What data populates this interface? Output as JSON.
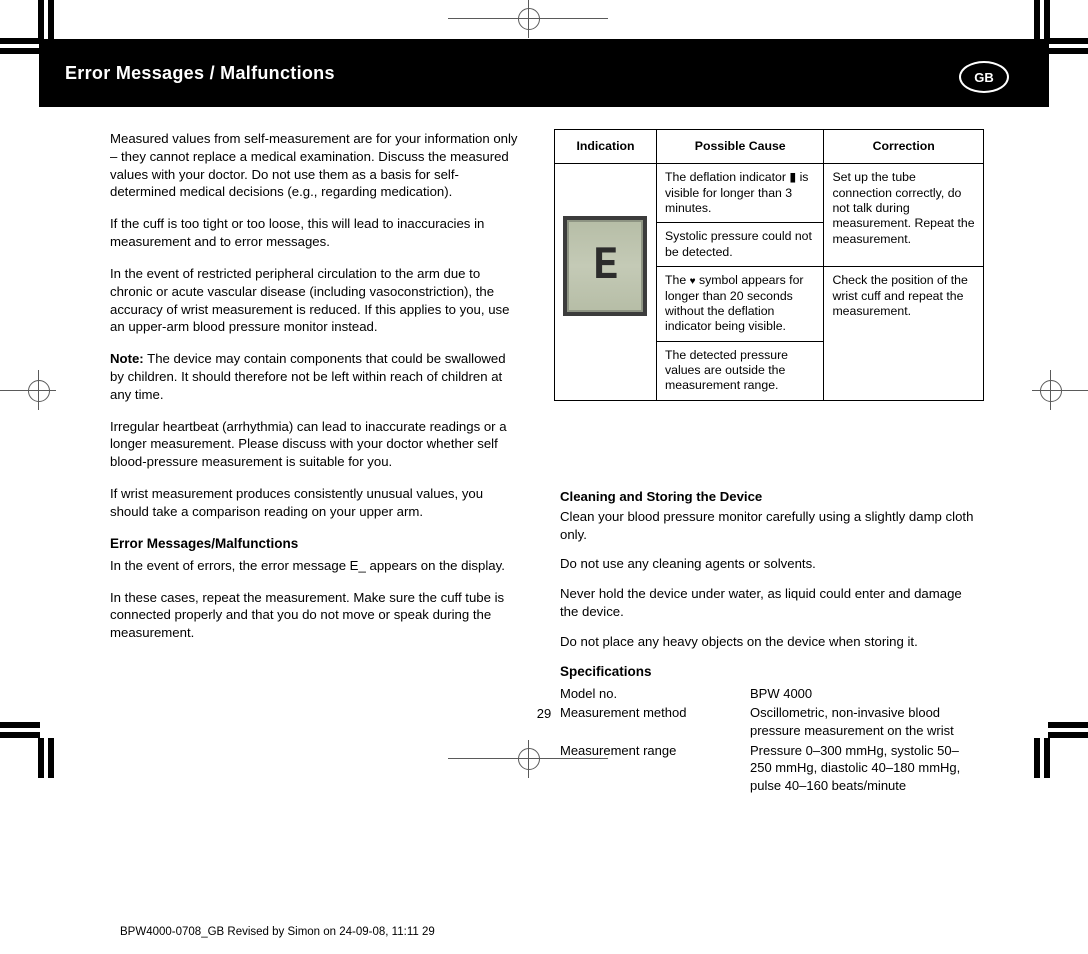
{
  "header": {
    "title": "Error Messages / Malfunctions",
    "lang_badge": "GB"
  },
  "left": {
    "p1": "Measured values from self-measurement are for your information only – they cannot replace a medical examination. Discuss the measured values with your doctor. Do not use them as a basis for self-determined medical decisions (e.g., regarding medication).",
    "p2": "If the cuff is too tight or too loose, this will lead to inaccuracies in measurement and to error messages.",
    "p3": "In the event of restricted peripheral circulation to the arm due to chronic or acute vascular disease (including vasoconstriction), the accuracy of wrist measurement is reduced. If this applies to you, use an upper-arm blood pressure monitor instead.",
    "note_label": "Note:",
    "note_body": "The device may contain components that could be swallowed by children. It should therefore not be left within reach of children at any time.",
    "p4": "Irregular heartbeat (arrhythmia) can lead to inaccurate readings or a longer measurement. Please discuss with your doctor whether self blood-pressure measurement is suitable for you.",
    "p5": "If wrist measurement produces consistently unusual values, you should take a comparison reading on your upper arm.",
    "error_head": "Error Messages/Malfunctions",
    "error_intro": "In the event of errors, the error message E_ appears on the display.",
    "error_tip": "In these cases, repeat the measurement. Make sure the cuff tube is connected properly and that you do not move or speak during the measurement."
  },
  "table": {
    "headers": [
      "Indication",
      "Possible Cause",
      "Correction"
    ],
    "symbol_char": "E",
    "rows": [
      {
        "cause": "The deflation indicator ▮ is visible for longer than 3 minutes.",
        "corr_rowspan_start": true,
        "correction": "Set up the tube connection correctly, do not talk during measurement. Repeat the measurement."
      },
      {
        "cause": "Systolic pressure could not be detected.",
        "corr_rowspan_start": false
      },
      {
        "cause_prefix": "The ",
        "cause_icon": "heart",
        "cause_suffix": " symbol appears for longer than 20 seconds without the deflation indicator being visible.",
        "corr_rowspan_start": true,
        "correction": "Check the position of the wrist cuff and repeat the measurement."
      },
      {
        "cause": "The detected pressure values are outside the measurement range.",
        "corr_rowspan_start": false
      }
    ]
  },
  "right": {
    "storage_head": "Cleaning and Storing the Device",
    "storage_list": [
      "Clean your blood pressure monitor carefully using a slightly damp cloth only.",
      "Do not use any cleaning agents or solvents.",
      "Never hold the device under water, as liquid could enter and damage the device.",
      "Do not place any heavy objects on the device when storing it."
    ],
    "spec_head": "Specifications",
    "specs": [
      {
        "label": "Model no.",
        "value": "BPW 4000"
      },
      {
        "label": "Measurement method",
        "value": "Oscillometric, non-invasive blood pressure measurement on the wrist"
      },
      {
        "label": "Measurement range",
        "value": "Pressure 0–300 mmHg, systolic 50–250 mmHg, diastolic 40–180 mmHg, pulse 40–160 beats/minute"
      }
    ]
  },
  "page_number": "29",
  "file_stamp": "BPW4000-0708_GB  Revised by Simon on 24-09-08, 11:11 29"
}
